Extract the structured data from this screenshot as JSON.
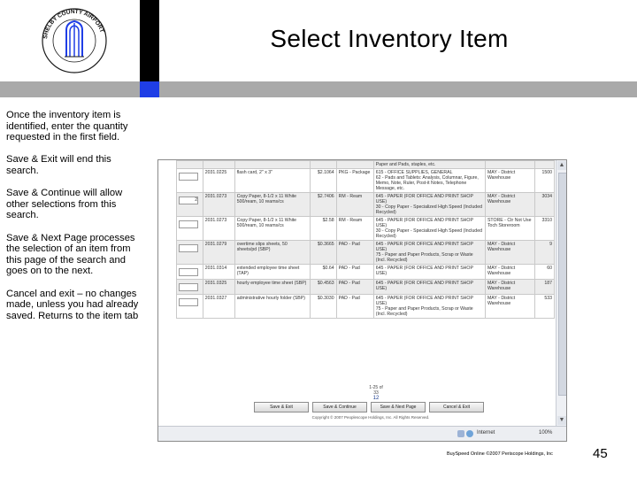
{
  "header": {
    "title": "Select Inventory Item",
    "logo_text": "SHELBY COUNTY AIRPORT AUTHORITY · MEMPHIS ·"
  },
  "notes": [
    "Once the inventory item is identified, enter the quantity requested in the first field.",
    "Save & Exit will end this search.",
    "Save & Continue will allow other selections from this search.",
    "Save & Next Page processes the selection of an item from this page of the search and goes on to the next.",
    "Cancel and exit – no changes made, unless you had already saved. Returns to the item tab"
  ],
  "screenshot": {
    "rows": [
      {
        "qty": "",
        "id": "",
        "desc": "",
        "price": "",
        "unit": "",
        "cat": "Paper and Pads, staples, etc.",
        "loc": "",
        "onhand": ""
      },
      {
        "qty": "",
        "id": "2031.0225",
        "desc": "flash card, 2\" x 3\"",
        "price": "$2.1064",
        "unit": "PKG - Package",
        "cat": "615 - OFFICE SUPPLIES, GENERAL\n62 - Pads and Tablets: Analysis, Columnar, Figure, Memo, Note, Ruler, Post-it Notes, Telephone Message, etc.",
        "loc": "MAY - District Warehouse",
        "onhand": "1500"
      },
      {
        "qty": "2",
        "id": "2031.0273",
        "desc": "Copy Paper, 8-1/2 x 11 White 500/ream, 10 reams/cs",
        "price": "$2.7406",
        "unit": "RM - Ream",
        "cat": "645 - PAPER (FOR OFFICE AND PRINT SHOP USE)\n30 - Copy Paper - Specialized High Speed (Included Recycled)",
        "loc": "MAY - District Warehouse",
        "onhand": "3034"
      },
      {
        "qty": "",
        "id": "2031.0273",
        "desc": "Copy Paper, 8-1/2 x 11 White 500/ream, 10 reams/cs",
        "price": "$2.58",
        "unit": "RM - Ream",
        "cat": "645 - PAPER (FOR OFFICE AND PRINT SHOP USE)\n30 - Copy Paper - Specialized High Speed (Included Recycled)",
        "loc": "STORE - Ctr Not Use Toch Storeroom",
        "onhand": "3310"
      },
      {
        "qty": "",
        "id": "2031.0279",
        "desc": "overtime slips sheets, 50 sheets/pd (SBP)",
        "price": "$0.3665",
        "unit": "PAD - Pad",
        "cat": "645 - PAPER (FOR OFFICE AND PRINT SHOP USE)\n75 - Paper and Paper Products, Scrap or Waste (Incl. Recycled)",
        "loc": "MAY - District Warehouse",
        "onhand": "9"
      },
      {
        "qty": "",
        "id": "2031.0314",
        "desc": "extended employee time sheet (TAP)",
        "price": "$0.64",
        "unit": "PAD - Pad",
        "cat": "645 - PAPER (FOR OFFICE AND PRINT SHOP USE)",
        "loc": "MAY - District Warehouse",
        "onhand": "60"
      },
      {
        "qty": "",
        "id": "2031.0325",
        "desc": "hourly employee time sheet (SBP)",
        "price": "$0.4563",
        "unit": "PAD - Pad",
        "cat": "645 - PAPER (FOR OFFICE AND PRINT SHOP USE)",
        "loc": "MAY - District Warehouse",
        "onhand": "187"
      },
      {
        "qty": "",
        "id": "2031.0327",
        "desc": "administrative hourly folder (SBP)",
        "price": "$0.3030",
        "unit": "PAD - Pad",
        "cat": "645 - PAPER (FOR OFFICE AND PRINT SHOP USE)\n75 - Paper and Paper Products, Scrap or Waste (Incl. Recycled)",
        "loc": "MAY - District Warehouse",
        "onhand": "533"
      }
    ],
    "pager_top": "1-25 of 33",
    "pager_bottom": "12",
    "buttons": [
      "Save & Exit",
      "Save & Continue",
      "Save & Next Page",
      "Cancel & Exit"
    ],
    "copyright": "Copyright © 2007 Peoplescope Holdings, Inc. All Rights Reserved.",
    "status_text": "Internet",
    "zoom": "100%"
  },
  "footer": {
    "credit": "BuySpeed Online ©2007 Periscope Holdings, Inc",
    "page_number": "45"
  },
  "colors": {
    "bar_black": "#000000",
    "bar_gray": "#a9a9a9",
    "bar_blue": "#1f3ee6"
  }
}
